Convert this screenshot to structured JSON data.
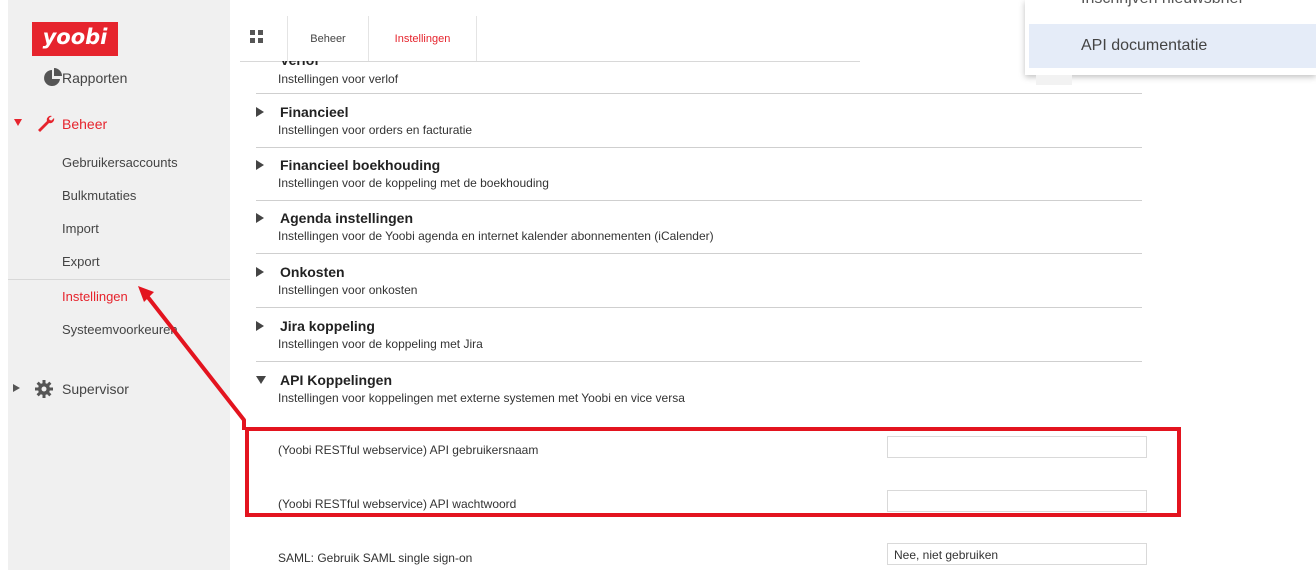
{
  "brand": {
    "logo": "yoobi",
    "accent": "#e6242d"
  },
  "sidebar": {
    "items": [
      {
        "label": "Rapporten",
        "icon": "pie-chart-icon"
      },
      {
        "label": "Beheer",
        "icon": "wrench-icon",
        "expanded": true
      },
      {
        "label": "Supervisor",
        "icon": "gear-icon",
        "expanded": false
      }
    ],
    "beheer_sub": [
      {
        "label": "Gebruikersaccounts"
      },
      {
        "label": "Bulkmutaties"
      },
      {
        "label": "Import"
      },
      {
        "label": "Export"
      },
      {
        "label": "Instellingen",
        "active": true
      },
      {
        "label": "Systeemvoorkeuren"
      }
    ]
  },
  "tabs": [
    {
      "label": "Beheer"
    },
    {
      "label": "Instellingen",
      "active": true
    }
  ],
  "sections": {
    "verlof": {
      "title": "Verlof",
      "desc": "Instellingen voor verlof"
    },
    "items": [
      {
        "title": "Financieel",
        "desc": "Instellingen voor orders en facturatie"
      },
      {
        "title": "Financieel boekhouding",
        "desc": "Instellingen voor de koppeling met de boekhouding"
      },
      {
        "title": "Agenda instellingen",
        "desc": "Instellingen voor de Yoobi agenda en internet kalender abonnementen (iCalender)"
      },
      {
        "title": "Onkosten",
        "desc": "Instellingen voor onkosten"
      },
      {
        "title": "Jira koppeling",
        "desc": "Instellingen voor de koppeling met Jira"
      },
      {
        "title": "API Koppelingen",
        "desc": "Instellingen voor koppelingen met externe systemen met Yoobi en vice versa",
        "expanded": true
      }
    ]
  },
  "fields": [
    {
      "label": "(Yoobi RESTful webservice) API gebruikersnaam",
      "value": ""
    },
    {
      "label": "(Yoobi RESTful webservice) API wachtwoord",
      "value": ""
    },
    {
      "label": "SAML: Gebruik SAML single sign-on",
      "value": "Nee, niet gebruiken"
    }
  ],
  "dropdown": {
    "items": [
      {
        "label": "Inschrijven nieuwsbrief"
      },
      {
        "label": "API documentatie",
        "highlighted": true
      }
    ]
  }
}
